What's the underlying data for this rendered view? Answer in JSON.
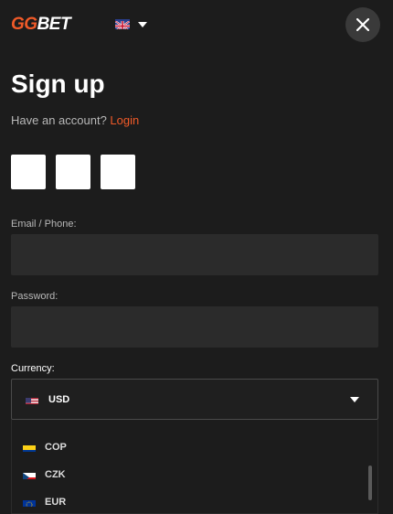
{
  "header": {
    "logo_gg": "GG",
    "logo_bet": "BET",
    "language_flag": "uk-flag-icon",
    "close_icon": "close-icon"
  },
  "title": "Sign up",
  "account_prompt": {
    "text": "Have an account? ",
    "link": "Login"
  },
  "social_buttons": [
    {
      "name": "social-login-1"
    },
    {
      "name": "social-login-2"
    },
    {
      "name": "social-login-3"
    }
  ],
  "form": {
    "email_label": "Email / Phone:",
    "email_value": "",
    "password_label": "Password:",
    "password_value": "",
    "currency_label": "Currency:",
    "currency_selected": "USD"
  },
  "currency_options": [
    {
      "code": "COP",
      "flag": "colombia-flag-icon"
    },
    {
      "code": "CZK",
      "flag": "czech-flag-icon"
    },
    {
      "code": "EUR",
      "flag": "eu-flag-icon"
    }
  ],
  "colors": {
    "accent": "#f05a28",
    "background": "#1c1c1c",
    "field": "#2b2b2b"
  }
}
